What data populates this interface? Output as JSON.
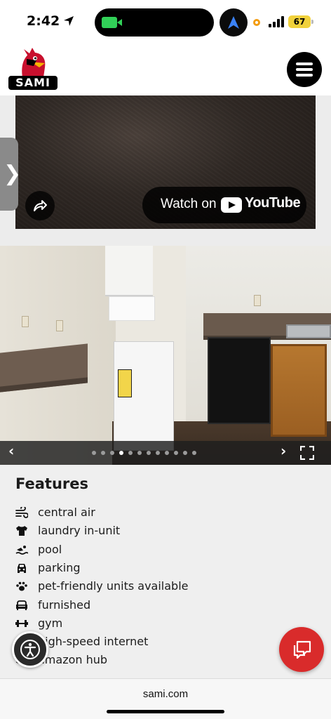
{
  "status_bar": {
    "time": "2:42",
    "battery": "67",
    "colors": {
      "camera_indicator": "#31d158",
      "battery": "#f1d13b",
      "location_dot": "#f39c12"
    }
  },
  "header": {
    "logo_text": "SAMI",
    "logo_icon": "cardinal-mascot-icon",
    "menu_icon": "hamburger-icon"
  },
  "video": {
    "watch_label": "Watch on",
    "brand": "YouTube",
    "share_icon": "share-icon",
    "side_tab_glyph": "❯"
  },
  "gallery": {
    "prev_glyph": "‹",
    "next_glyph": "›",
    "total_photos": 12,
    "active_index": 4,
    "fullscreen_icon": "fullscreen-icon"
  },
  "features": {
    "title": "Features",
    "items": [
      {
        "label": "central air",
        "icon": "air-flow-icon"
      },
      {
        "label": "laundry in-unit",
        "icon": "tshirt-icon"
      },
      {
        "label": "pool",
        "icon": "swimmer-icon"
      },
      {
        "label": "parking",
        "icon": "car-icon"
      },
      {
        "label": "pet-friendly units available",
        "icon": "paw-icon"
      },
      {
        "label": "furnished",
        "icon": "couch-icon"
      },
      {
        "label": "gym",
        "icon": "dumbbell-icon"
      },
      {
        "label": "high-speed internet",
        "icon": "wifi-icon"
      },
      {
        "label": "amazon hub",
        "icon": "amazon-icon"
      }
    ]
  },
  "floating": {
    "accessibility_icon": "accessibility-icon",
    "chat_icon": "chat-icon",
    "chat_color": "#d92b2b"
  },
  "browser": {
    "url": "sami.com"
  }
}
